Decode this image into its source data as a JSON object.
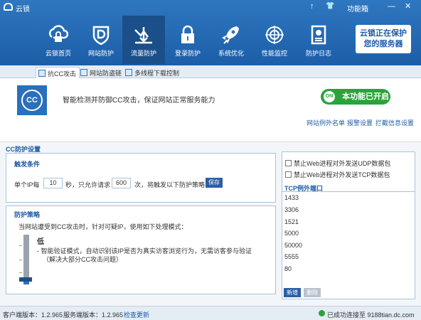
{
  "window": {
    "title": "云锁",
    "controls": [
      "↑",
      "👕",
      "功能箱",
      "—",
      "✕"
    ],
    "func_box": "功能箱"
  },
  "nav": [
    {
      "label": "云锁首页",
      "icon": "cloud-lock-icon"
    },
    {
      "label": "网站防护",
      "icon": "shield-d-icon"
    },
    {
      "label": "流量防护",
      "icon": "traffic-arrow-icon",
      "active": true
    },
    {
      "label": "登录防护",
      "icon": "padlock-icon"
    },
    {
      "label": "系统优化",
      "icon": "rocket-icon"
    },
    {
      "label": "性能监控",
      "icon": "radar-icon"
    },
    {
      "label": "防护日志",
      "icon": "log-document-icon"
    }
  ],
  "promo": {
    "line1": "云锁正在保护",
    "line2": "您的服务器"
  },
  "tabs": [
    {
      "label": "抗CC攻击",
      "active": true
    },
    {
      "label": "网站防盗链"
    },
    {
      "label": "多线程下载控制"
    }
  ],
  "info": {
    "badge": "CC",
    "description": "智能检测并防御CC攻击，保证网站正常服务能力",
    "toggle_on": "ON",
    "toggle_label": "本功能已开启",
    "links": [
      "网站例外名单",
      "报警设置",
      "拦截信息设置"
    ]
  },
  "settings": {
    "title": "CC防护设置",
    "trigger": {
      "title": "触发条件",
      "t1": "单个IP每",
      "seconds": "10",
      "t2": "秒，只允许请求",
      "requests": "600",
      "t3": "次，将触发以下防护策略",
      "save": "保存"
    },
    "strategy": {
      "title": "防护策略",
      "intro": "当网站遭受到CC攻击时，针对可疑IP，使用如下处理模式：",
      "level": "低",
      "detail1": "- 智能验证模式，自动识别该IP是否为真实访客浏览行为，无需访客参与验证",
      "detail2": "（解决大部分CC攻击问题）",
      "slider_level": 0.1
    }
  },
  "right": {
    "cb_udp": "禁止Web进程对外发送UDP数据包",
    "cb_tcp": "禁止Web进程对外发送TCP数据包",
    "ports_title": "TCP例外端口",
    "ports": [
      "1433",
      "3306",
      "1521",
      "5000",
      "50000",
      "5555",
      "80"
    ],
    "add": "新增",
    "delete": "删除"
  },
  "status": {
    "client_version": "客户端版本：1.2.965",
    "server_version": "服务端版本：1.2.965",
    "check_update": "检查更新",
    "connected": "已成功连接至 9188tian.dc.com"
  },
  "colors": {
    "primary": "#1e5ba6",
    "toolbar": "#2f77c0",
    "success": "#2aa33a"
  }
}
